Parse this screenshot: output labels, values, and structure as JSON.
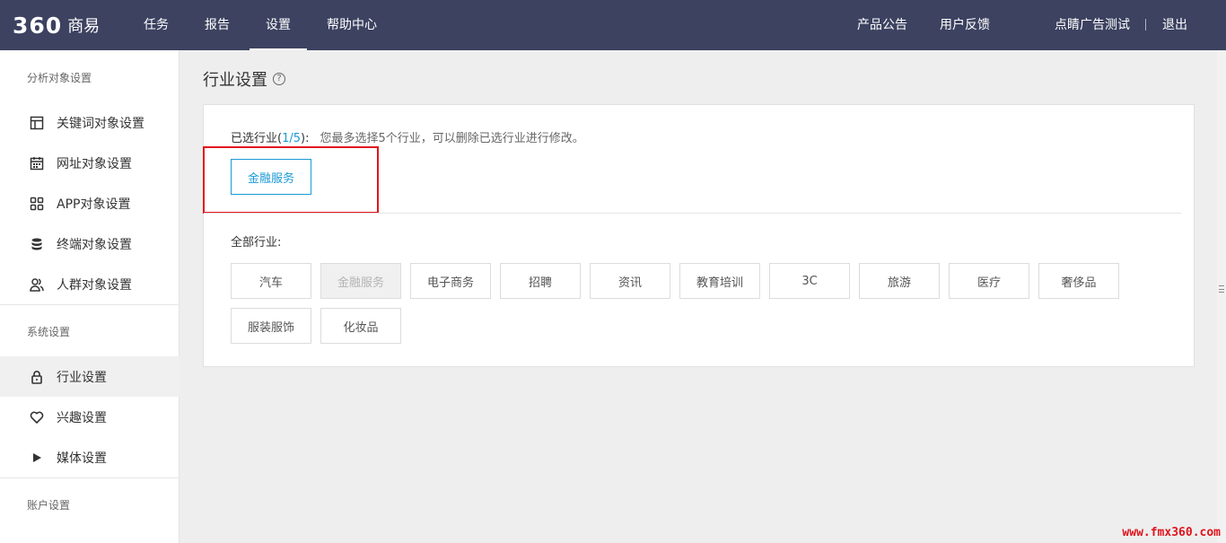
{
  "header": {
    "logo_num": "360",
    "logo_text": "商易",
    "nav": [
      "任务",
      "报告",
      "设置",
      "帮助中心"
    ],
    "right": [
      "产品公告",
      "用户反馈",
      "点睛广告测试",
      "退出"
    ]
  },
  "sidebar": {
    "section1": "分析对象设置",
    "items1": [
      "关键词对象设置",
      "网址对象设置",
      "APP对象设置",
      "终端对象设置",
      "人群对象设置"
    ],
    "section2": "系统设置",
    "items2": [
      "行业设置",
      "兴趣设置",
      "媒体设置"
    ],
    "section3": "账户设置"
  },
  "main": {
    "title": "行业设置",
    "help_glyph": "?",
    "selected_label": "已选行业(",
    "selected_count": "1/5",
    "selected_close": "):",
    "selected_hint": "您最多选择5个行业，可以删除已选行业进行修改。",
    "selected_tags": [
      "金融服务"
    ],
    "all_label": "全部行业:",
    "industries": [
      "汽车",
      "金融服务",
      "电子商务",
      "招聘",
      "资讯",
      "教育培训",
      "3C",
      "旅游",
      "医疗",
      "奢侈品",
      "服装服饰",
      "化妆品"
    ]
  },
  "watermark": "www.fmx360.com",
  "colors": {
    "topbar": "#3c4260",
    "accent": "#1a9ad6",
    "highlight": "#e0141e"
  }
}
